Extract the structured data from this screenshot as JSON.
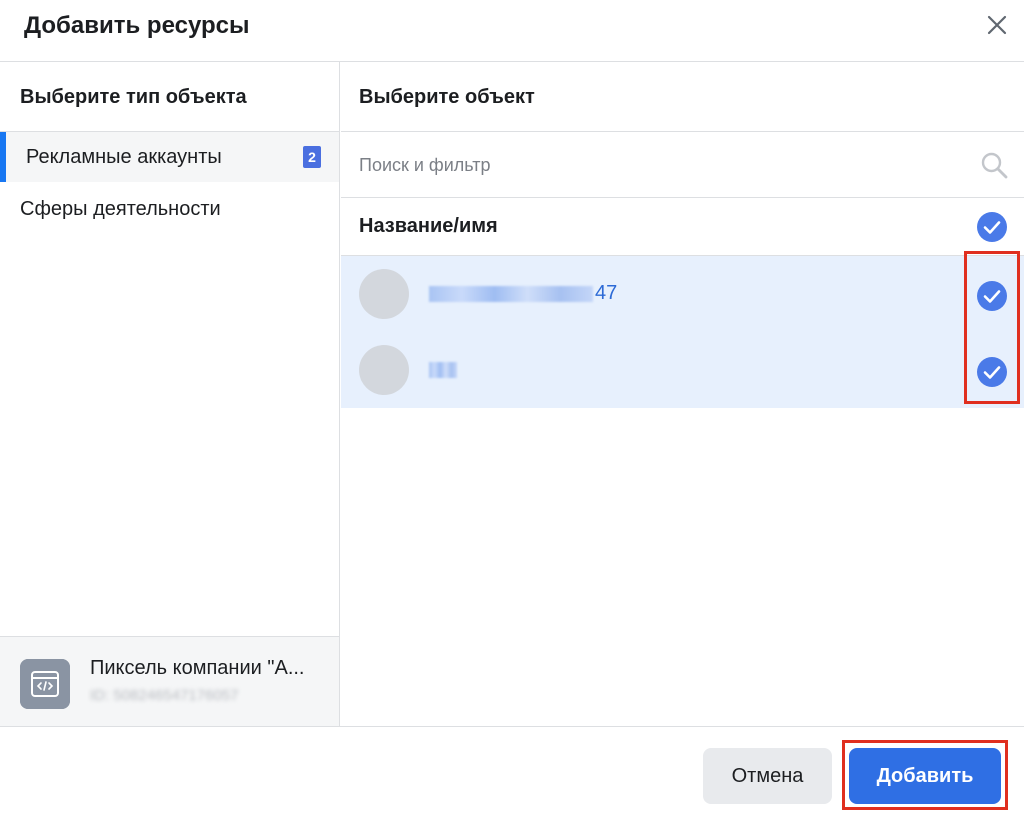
{
  "dialog": {
    "title": "Добавить ресурсы",
    "close_icon": "close-icon"
  },
  "left_panel": {
    "heading": "Выберите тип объекта",
    "items": [
      {
        "label": "Рекламные аккаунты",
        "badge": "2",
        "active": true
      },
      {
        "label": "Сферы деятельности",
        "active": false
      }
    ],
    "pixel": {
      "icon": "code-window-icon",
      "name": "Пиксель компании \"А...",
      "id_text": "ID: 508246547176057"
    }
  },
  "right_panel": {
    "heading": "Выберите объект",
    "search": {
      "placeholder": "Поиск и фильтр",
      "value": "",
      "icon": "search-icon"
    },
    "column_header": "Название/имя",
    "rows": [
      {
        "name_suffix": "47",
        "checked": true
      },
      {
        "name_suffix": "",
        "checked": true
      }
    ]
  },
  "footer": {
    "cancel_label": "Отмена",
    "add_label": "Добавить"
  },
  "colors": {
    "accent": "#2f6fe4",
    "selected_row_bg": "#e7f0fd",
    "check_fill": "#4a7ae8",
    "highlight_border": "#e02f1f"
  }
}
